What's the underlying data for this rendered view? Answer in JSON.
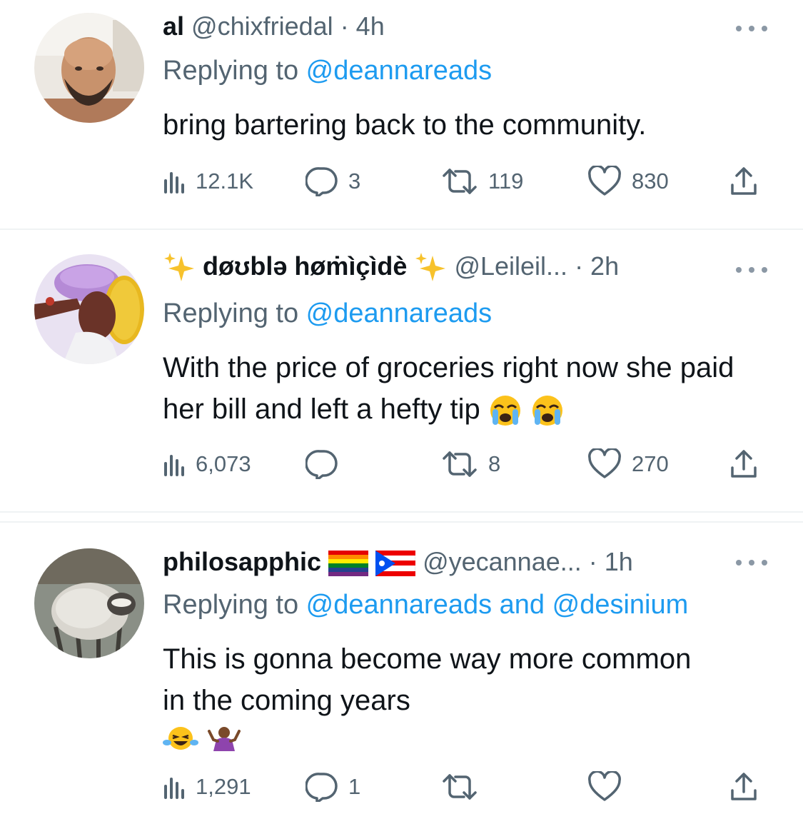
{
  "tweets": [
    {
      "name": "al",
      "handle": "@chixfriedal",
      "time": "· 4h",
      "replying_prefix": "Replying to ",
      "replying_to": "@deannareads",
      "text": "bring bartering back to the community.",
      "stats": {
        "views": "12.1K",
        "replies": "3",
        "retweets": "119",
        "likes": "830"
      }
    },
    {
      "name": "døʊblə høṁìçìdè",
      "handle": "@Leileil...",
      "time": "· 2h",
      "replying_prefix": "Replying to ",
      "replying_to": "@deannareads",
      "text": "With the price of groceries right now she paid her bill and left a hefty tip",
      "stats": {
        "views": "6,073",
        "replies": "",
        "retweets": "8",
        "likes": "270"
      }
    },
    {
      "name": "philosapphic",
      "handle": "@yecannae...",
      "time": "· 1h",
      "replying_prefix": "Replying to ",
      "replying_to": "@deannareads and @desinium",
      "text_line1": "This is gonna become way more common",
      "text_line2": "in the coming years",
      "stats": {
        "views": "1,291",
        "replies": "1",
        "retweets": "",
        "likes": ""
      }
    }
  ],
  "icons": [
    "views-icon",
    "reply-icon",
    "retweet-icon",
    "like-icon",
    "share-icon",
    "more-icon",
    "sparkle-icon",
    "rainbow-flag-icon",
    "puerto-rico-flag-icon",
    "crying-face-icon",
    "laughing-face-icon",
    "shrug-icon"
  ],
  "colors": {
    "link": "#1d9bf0",
    "secondary": "#536471",
    "text": "#0f1419",
    "divider": "#eff3f4"
  }
}
